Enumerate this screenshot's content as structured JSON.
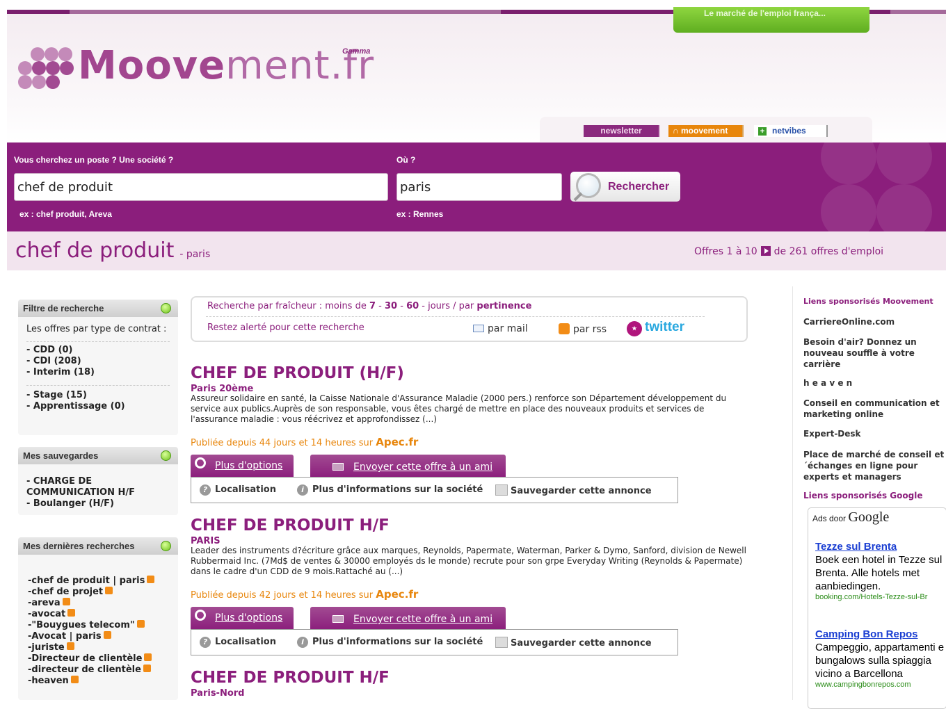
{
  "header": {
    "promo_tab": "Le marché de l'emploi frança...",
    "logo_bold": "Moove",
    "logo_light": "ment.fr",
    "logo_tag": "Gamma"
  },
  "feeds": {
    "newsletter": "newsletter",
    "rss": "moovement",
    "netvibes": "netvibes"
  },
  "search": {
    "what_label": "Vous cherchez un poste ? Une société ?",
    "what_value": "chef de produit",
    "what_example": "ex : chef produit, Areva",
    "where_label": "Où ?",
    "where_value": "paris",
    "where_example": "ex : Rennes",
    "button": "Rechercher"
  },
  "title": {
    "query": "chef de produit",
    "location": "- paris",
    "offers_a": "Offres 1 à 10",
    "offers_b": "de 261 offres d'emploi"
  },
  "filter": {
    "title": "Filtre de recherche",
    "intro": "Les offres par type de contrat :",
    "items": [
      "- CDD (0)",
      "- CDI (208)",
      "- Interim (18)",
      "- Stage (15)",
      "- Apprentissage (0)"
    ]
  },
  "saved": {
    "title": "Mes sauvegardes",
    "items": [
      "- CHARGE DE COMMUNICATION H/F",
      "- Boulanger (H/F)"
    ]
  },
  "recent": {
    "title": "Mes dernières recherches",
    "items": [
      "-chef de produit | paris",
      "-chef de projet",
      "-areva",
      "-avocat",
      "-\"Bouygues telecom\"",
      "-Avocat | paris",
      "-juriste",
      "-Directeur de clientèle",
      "-directeur de clientèle",
      "-heaven"
    ]
  },
  "fresh": {
    "prefix": "Recherche par fraîcheur : moins de",
    "d7": "7",
    "d30": "30",
    "d60": "60",
    "suffix": "- jours / par",
    "relevance": "pertinence",
    "alert": "Restez alerté pour cette recherche",
    "mail": "par mail",
    "rss": "par rss",
    "twitter": "twitter"
  },
  "jobs": [
    {
      "title": "CHEF DE PRODUIT (H/F)",
      "location": "Paris 20ème",
      "desc": "Assureur solidaire en santé, la Caisse Nationale d'Assurance Maladie (2000 pers.) renforce son Département développement du service aux publics.Auprès de son responsable, vous êtes chargé de mettre en place des nouveaux produits et services de l'assurance maladie : vous réécrivez et approfondissez  (...)",
      "published": "Publiée depuis 44 jours et 14 heures sur",
      "source": "Apec.fr"
    },
    {
      "title": "CHEF DE PRODUIT H/F",
      "location": "PARIS",
      "desc": "Leader des instruments d?écriture grâce aux marques, Reynolds, Papermate, Waterman, Parker & Dymo, Sanford, division de Newell Rubbermaid Inc. (7Md$ de ventes & 30000 employés ds le monde) recrute pour son grpe Everyday Writing (Reynolds & Papermate) dans le cadre d'un CDD de 9 mois.Rattaché au  (...)",
      "published": "Publiée depuis 42 jours et 14 heures sur",
      "source": "Apec.fr"
    },
    {
      "title": "CHEF DE PRODUIT H/F",
      "location": "Paris-Nord"
    }
  ],
  "job_actions": {
    "options": "Plus d'options",
    "send": "Envoyer cette offre à un ami",
    "location": "Localisation",
    "company": "Plus d'informations sur la société",
    "save": "Sauvegarder cette annonce"
  },
  "right": {
    "sponsored_title": "Liens sponsorisés Moovement",
    "l1": "CarriereOnline.com",
    "l1_desc": "Besoin d'air? Donnez un nouveau souffle à votre carrière",
    "l2": "h e a v e n",
    "l2_desc": "Conseil en communication et marketing online",
    "l3": "Expert-Desk",
    "l3_desc": "Place de marché de conseil et ´échanges en ligne pour experts et managers",
    "google_title": "Liens sponsorisés Google",
    "ads_label": "Ads door",
    "ads_brand": "Google",
    "ads": [
      {
        "title": "Tezze sul Brenta",
        "text": "Boek een hotel in Tezze sul Brenta. Alle hotels met aanbiedingen.",
        "url": "booking.com/Hotels-Tezze-sul-Br"
      },
      {
        "title": "Camping Bon Repos",
        "text": "Campeggio, appartamenti e bungalows sulla spiaggia vicino a Barcellona",
        "url": "www.campingbonrepos.com"
      }
    ]
  }
}
